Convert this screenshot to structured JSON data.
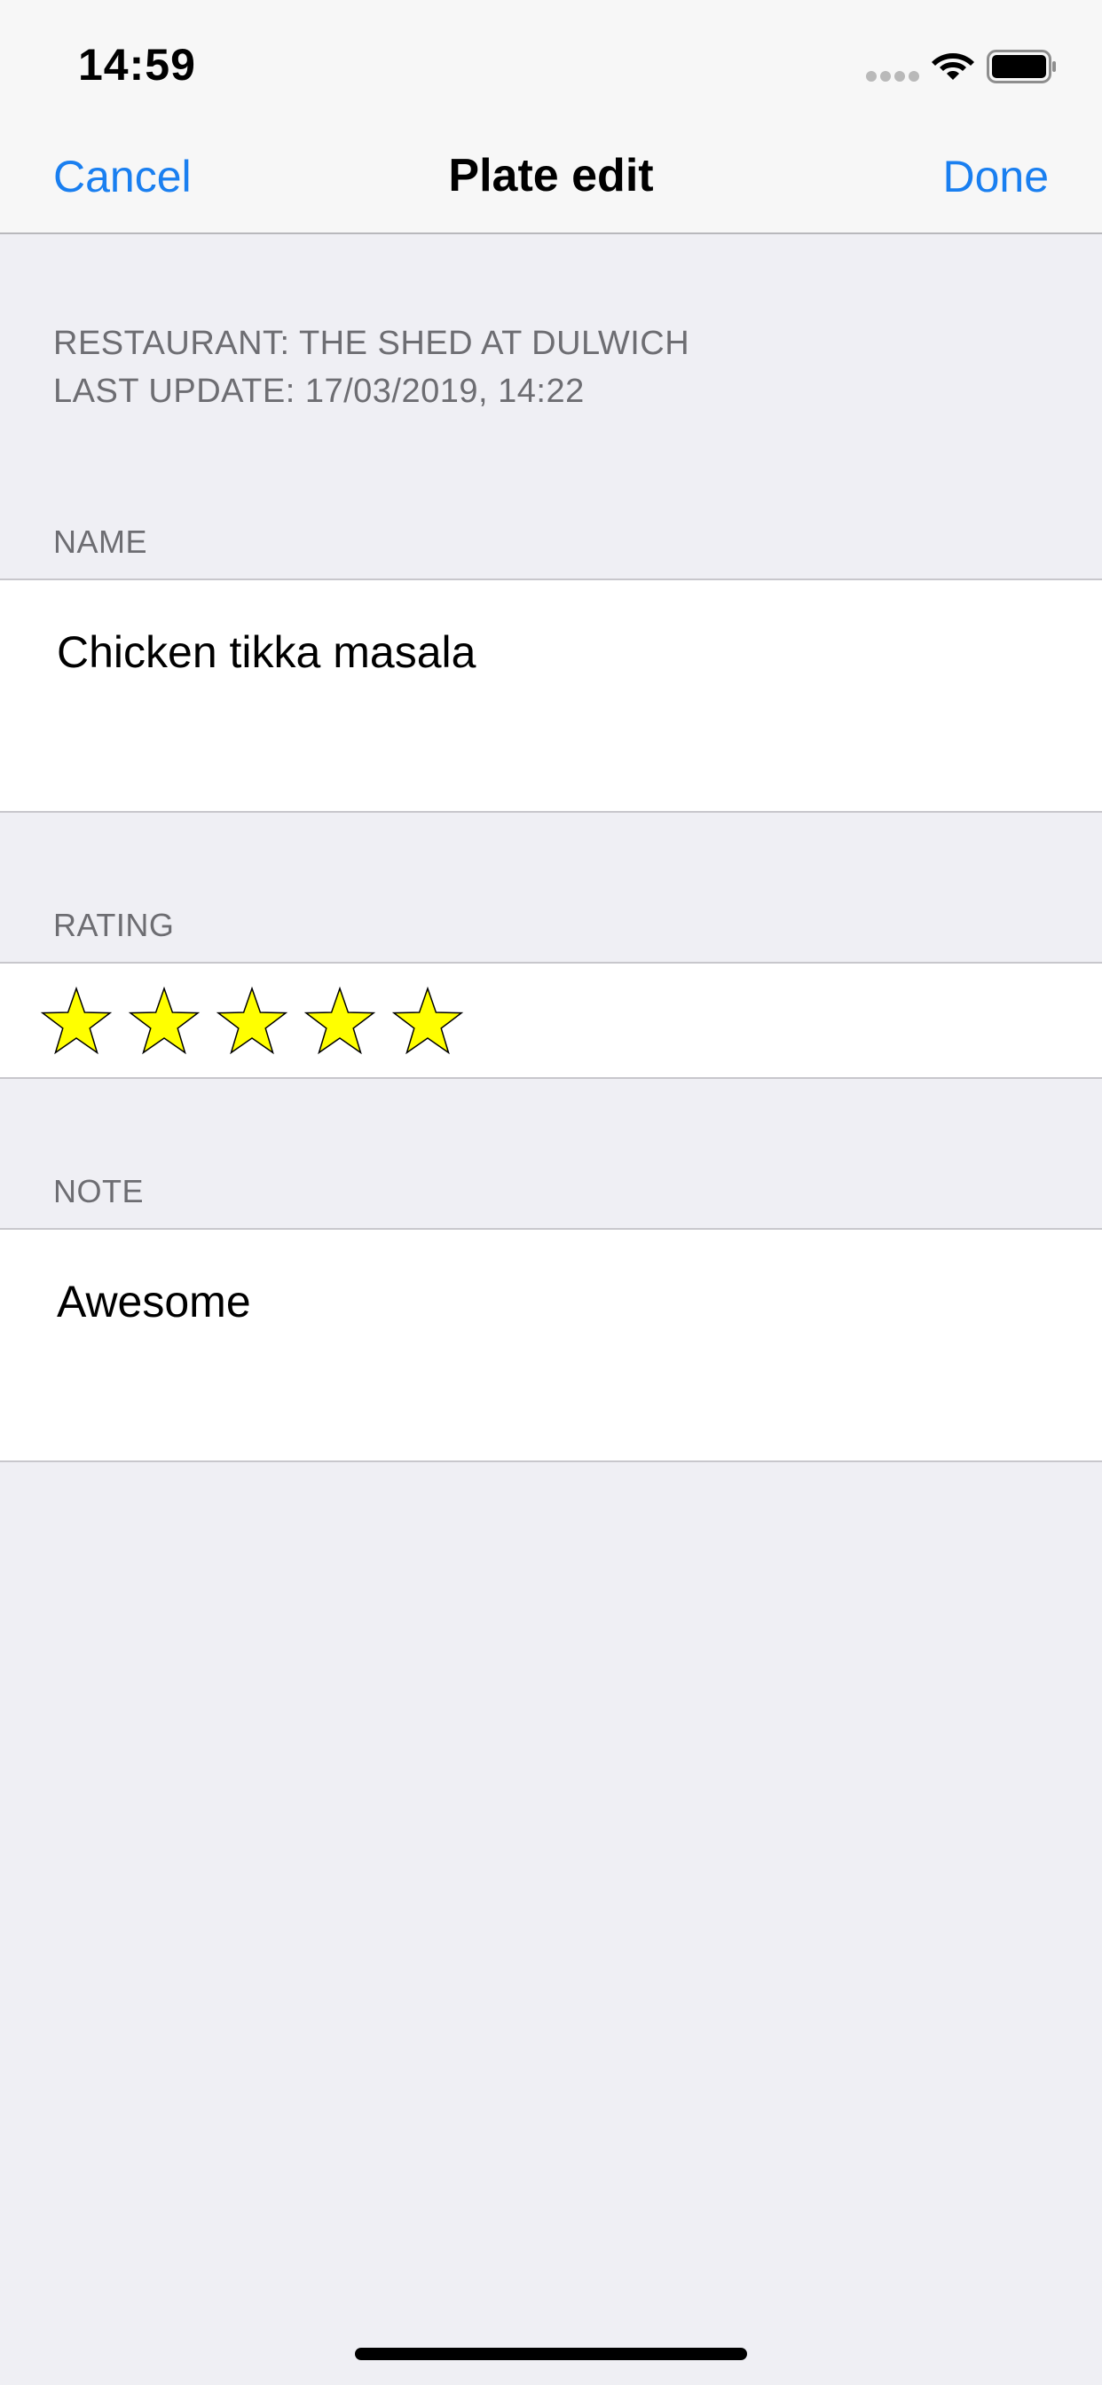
{
  "status_bar": {
    "time": "14:59",
    "icons": [
      "signal-dots-icon",
      "wifi-icon",
      "battery-icon"
    ]
  },
  "nav": {
    "cancel_label": "Cancel",
    "title": "Plate edit",
    "done_label": "Done"
  },
  "info": {
    "restaurant": "RESTAURANT: THE SHED AT DULWICH",
    "last_update": "LAST UPDATE: 17/03/2019, 14:22"
  },
  "form": {
    "name_header": "NAME",
    "name_value": "Chicken tikka masala",
    "rating_header": "RATING",
    "rating": {
      "value": 5,
      "max": 5
    },
    "note_header": "NOTE",
    "note_value": "Awesome"
  },
  "colors": {
    "accent": "#1a7ff0",
    "star_fill": "#ffff00",
    "background": "#efeff4"
  }
}
